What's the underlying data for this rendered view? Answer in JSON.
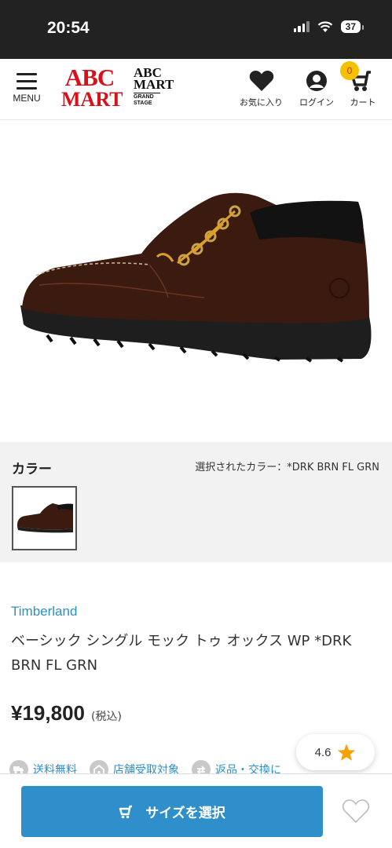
{
  "status_bar": {
    "time": "20:54",
    "battery": "37"
  },
  "header": {
    "menu_label": "MENU",
    "logo_abc_line1": "ABC",
    "logo_abc_line2": "MART",
    "logo_gs_line1": "ABC",
    "logo_gs_line2": "MART",
    "logo_gs_line3": "GRAND STAGE",
    "favorites_label": "お気に入り",
    "login_label": "ログイン",
    "cart_label": "カート",
    "cart_count": "0"
  },
  "color": {
    "title": "カラー",
    "selected": "選択されたカラー：*DRK BRN FL GRN"
  },
  "product": {
    "brand": "Timberland",
    "name": "ベーシック シングル モック トゥ オックス WP *DRK BRN FL GRN",
    "price": "¥19,800",
    "tax": "(税込)",
    "rating": "4.6"
  },
  "features": [
    {
      "label": "送料無料",
      "icon": "truck-icon"
    },
    {
      "label": "店舗受取対象",
      "icon": "store-icon"
    },
    {
      "label": "返品・交換に",
      "icon": "exchange-icon"
    }
  ],
  "actions": {
    "select_size": "サイズを選択"
  },
  "colors": {
    "accent": "#2f8fca",
    "brand_red": "#d9101a",
    "badge": "#f5c000",
    "star": "#f5a100"
  }
}
